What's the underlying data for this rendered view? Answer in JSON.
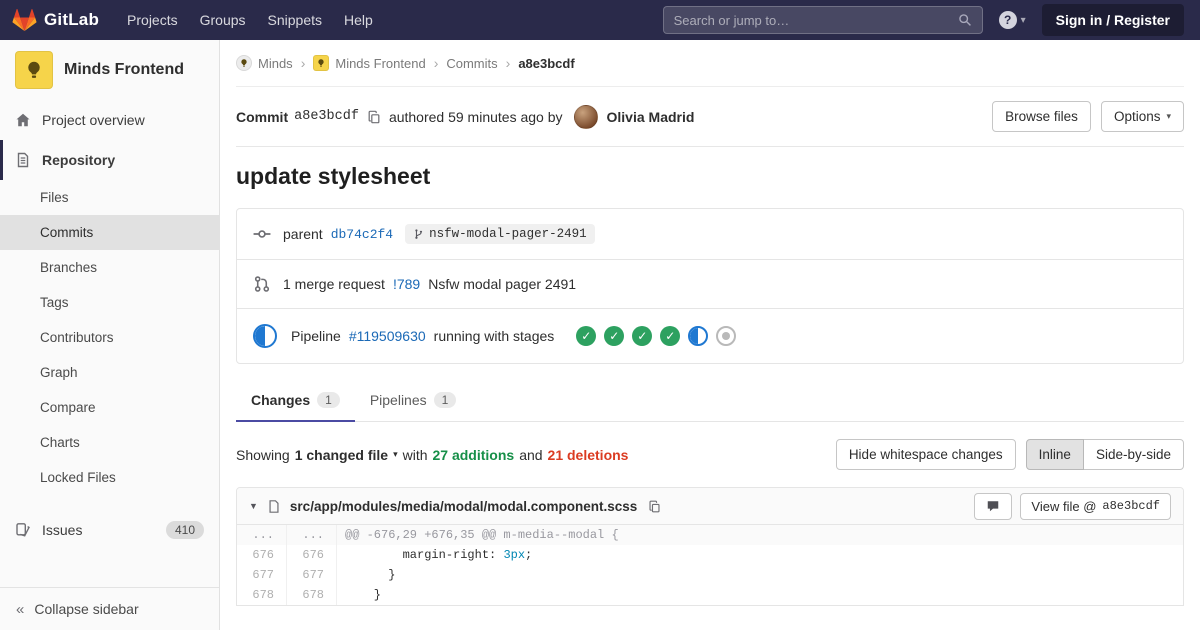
{
  "icons": {
    "caret_down": "▾",
    "collapse_caret": "▼",
    "collapse_sidebar": "«",
    "help": "?",
    "check": "✓",
    "breadcrumb_sep": "›"
  },
  "colors": {
    "navbar_bg": "#2a2a4a",
    "tab_accent": "#4b4ba3",
    "link_blue": "#1b69b6",
    "success_green": "#2da160",
    "running_blue": "#1f78d1",
    "addition_green": "#168f48",
    "deletion_red": "#db3b21"
  },
  "navbar": {
    "brand": "GitLab",
    "links": [
      {
        "label": "Projects"
      },
      {
        "label": "Groups"
      },
      {
        "label": "Snippets"
      },
      {
        "label": "Help"
      }
    ],
    "search_placeholder": "Search or jump to…",
    "sign_in_label": "Sign in / Register"
  },
  "sidebar": {
    "project_title": "Minds Frontend",
    "overview_label": "Project overview",
    "repository_label": "Repository",
    "repo_items": [
      {
        "label": "Files"
      },
      {
        "label": "Commits",
        "active": true
      },
      {
        "label": "Branches"
      },
      {
        "label": "Tags"
      },
      {
        "label": "Contributors"
      },
      {
        "label": "Graph"
      },
      {
        "label": "Compare"
      },
      {
        "label": "Charts"
      },
      {
        "label": "Locked Files"
      }
    ],
    "issues_label": "Issues",
    "issues_count": "410",
    "collapse_label": "Collapse sidebar"
  },
  "breadcrumb": {
    "items": [
      "Minds",
      "Minds Frontend",
      "Commits",
      "a8e3bcdf"
    ]
  },
  "commit": {
    "label": "Commit",
    "sha": "a8e3bcdf",
    "authored_text": "authored 59 minutes ago by",
    "author": "Olivia Madrid",
    "browse_files_label": "Browse files",
    "options_label": "Options",
    "title": "update stylesheet"
  },
  "commit_box": {
    "parent_label": "parent",
    "parent_sha": "db74c2f4",
    "branch": "nsfw-modal-pager-2491",
    "mr_count_text": "1 merge request",
    "mr_id": "!789",
    "mr_title": "Nsfw modal pager 2491",
    "pipeline": {
      "label": "Pipeline",
      "id": "#119509630",
      "status_text": "running with stages",
      "stages": [
        "passed",
        "passed",
        "passed",
        "passed",
        "running",
        "created"
      ]
    }
  },
  "tabs": [
    {
      "label": "Changes",
      "count": "1",
      "active": true
    },
    {
      "label": "Pipelines",
      "count": "1",
      "active": false
    }
  ],
  "diff": {
    "showing_label": "Showing",
    "changed_files_label": "1 changed file",
    "with_label": "with",
    "additions_label": "27 additions",
    "and_label": "and",
    "deletions_label": "21 deletions",
    "hide_whitespace_label": "Hide whitespace changes",
    "inline_label": "Inline",
    "side_by_side_label": "Side-by-side",
    "file": {
      "path": "src/app/modules/media/modal/modal.component.scss",
      "view_file_label": "View file @",
      "view_file_sha": "a8e3bcdf"
    },
    "lines": [
      {
        "old": "...",
        "new": "...",
        "code_pre": "@@ -676,29 +676,35 @@ m-media--modal {",
        "type": "meta"
      },
      {
        "old": "676",
        "new": "676",
        "code_pre": "        margin-right: ",
        "code_value": "3px",
        "code_post": ";",
        "type": "context"
      },
      {
        "old": "677",
        "new": "677",
        "code_pre": "      }",
        "type": "context"
      },
      {
        "old": "678",
        "new": "678",
        "code_pre": "    }",
        "type": "context"
      }
    ]
  }
}
